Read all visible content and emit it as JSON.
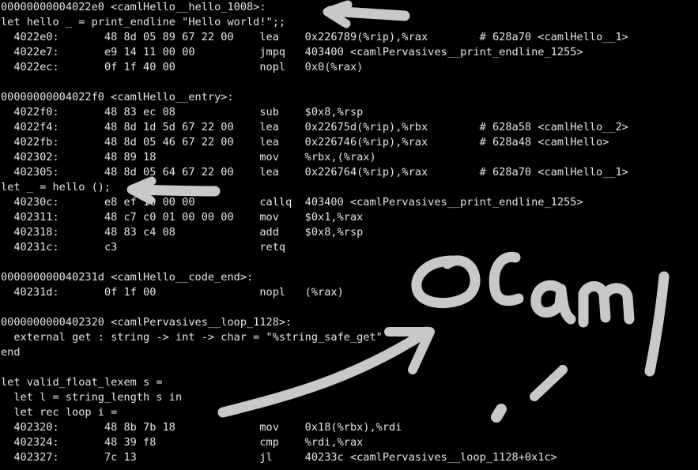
{
  "terminal": {
    "background": "#000000",
    "text_color": "#e6e6e6",
    "lines": [
      "00000000004022e0 <camlHello__hello_1008>:",
      "let hello _ = print_endline \"Hello world!\";;",
      "  4022e0:       48 8d 05 89 67 22 00    lea    0x226789(%rip),%rax        # 628a70 <camlHello__1>",
      "  4022e7:       e9 14 11 00 00          jmpq   403400 <camlPervasives__print_endline_1255>",
      "  4022ec:       0f 1f 40 00             nopl   0x0(%rax)",
      "",
      "00000000004022f0 <camlHello__entry>:",
      "  4022f0:       48 83 ec 08             sub    $0x8,%rsp",
      "  4022f4:       48 8d 1d 5d 67 22 00    lea    0x22675d(%rip),%rbx        # 628a58 <camlHello__2>",
      "  4022fb:       48 8d 05 46 67 22 00    lea    0x226746(%rip),%rax        # 628a48 <camlHello>",
      "  402302:       48 89 18                mov    %rbx,(%rax)",
      "  402305:       48 8d 05 64 67 22 00    lea    0x226764(%rip),%rax        # 628a70 <camlHello__1>",
      "let _ = hello ();",
      "  40230c:       e8 ef 10 00 00          callq  403400 <camlPervasives__print_endline_1255>",
      "  402311:       48 c7 c0 01 00 00 00    mov    $0x1,%rax",
      "  402318:       48 83 c4 08             add    $0x8,%rsp",
      "  40231c:       c3                      retq",
      "",
      "000000000040231d <camlHello__code_end>:",
      "  40231d:       0f 1f 00                nopl   (%rax)",
      "",
      "0000000000402320 <camlPervasives__loop_1128>:",
      "  external get : string -> int -> char = \"%string_safe_get\"",
      "end",
      "",
      "let valid_float_lexem s =",
      "  let l = string_length s in",
      "  let rec loop i =",
      "  402320:       48 8b 7b 18             mov    0x18(%rbx),%rdi",
      "  402324:       48 39 f8                cmp    %rdi,%rax",
      "  402327:       7c 13                   jl     40233c <camlPervasives__loop_1128+0x1c>"
    ]
  },
  "annotation": {
    "handwritten_text": "OCaml",
    "ink_color": "#c8c8c8"
  }
}
